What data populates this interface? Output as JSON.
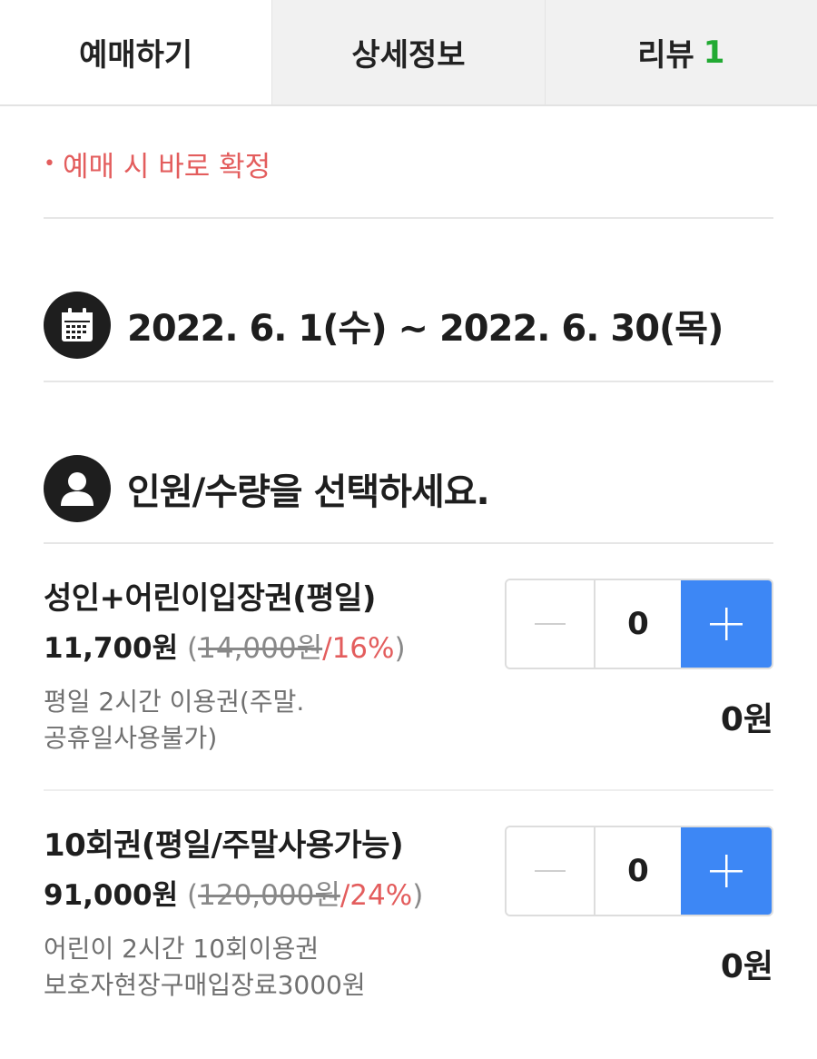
{
  "tabs": [
    {
      "label": "예매하기",
      "active": true
    },
    {
      "label": "상세정보",
      "active": false
    },
    {
      "label": "리뷰",
      "count": "1",
      "active": false
    }
  ],
  "notice": {
    "bullet": "•",
    "text": "예매 시 바로 확정"
  },
  "date_range": {
    "icon": "calendar-icon",
    "text": "2022. 6. 1(수) ~ 2022. 6. 30(목)"
  },
  "people": {
    "icon": "user-icon",
    "text": "인원/수량을 선택하세요."
  },
  "products": [
    {
      "name": "성인+어린이입장권(평일)",
      "price": "11,700원",
      "original_price": "14,000원",
      "discount": "/16%",
      "desc_lines": [
        "평일 2시간 이용권(주말.",
        "공휴일사용불가)"
      ],
      "quantity": "0",
      "subtotal": "0원"
    },
    {
      "name": "10회권(평일/주말사용가능)",
      "price": "91,000원",
      "original_price": "120,000원",
      "discount": "/24%",
      "desc_lines": [
        "어린이 2시간 10회이용권",
        "보호자현장구매입장료3000원"
      ],
      "quantity": "0",
      "subtotal": "0원"
    }
  ],
  "colors": {
    "accent_blue": "#3d87f5",
    "discount_red": "#e35d5d",
    "review_green": "#22aa33"
  }
}
